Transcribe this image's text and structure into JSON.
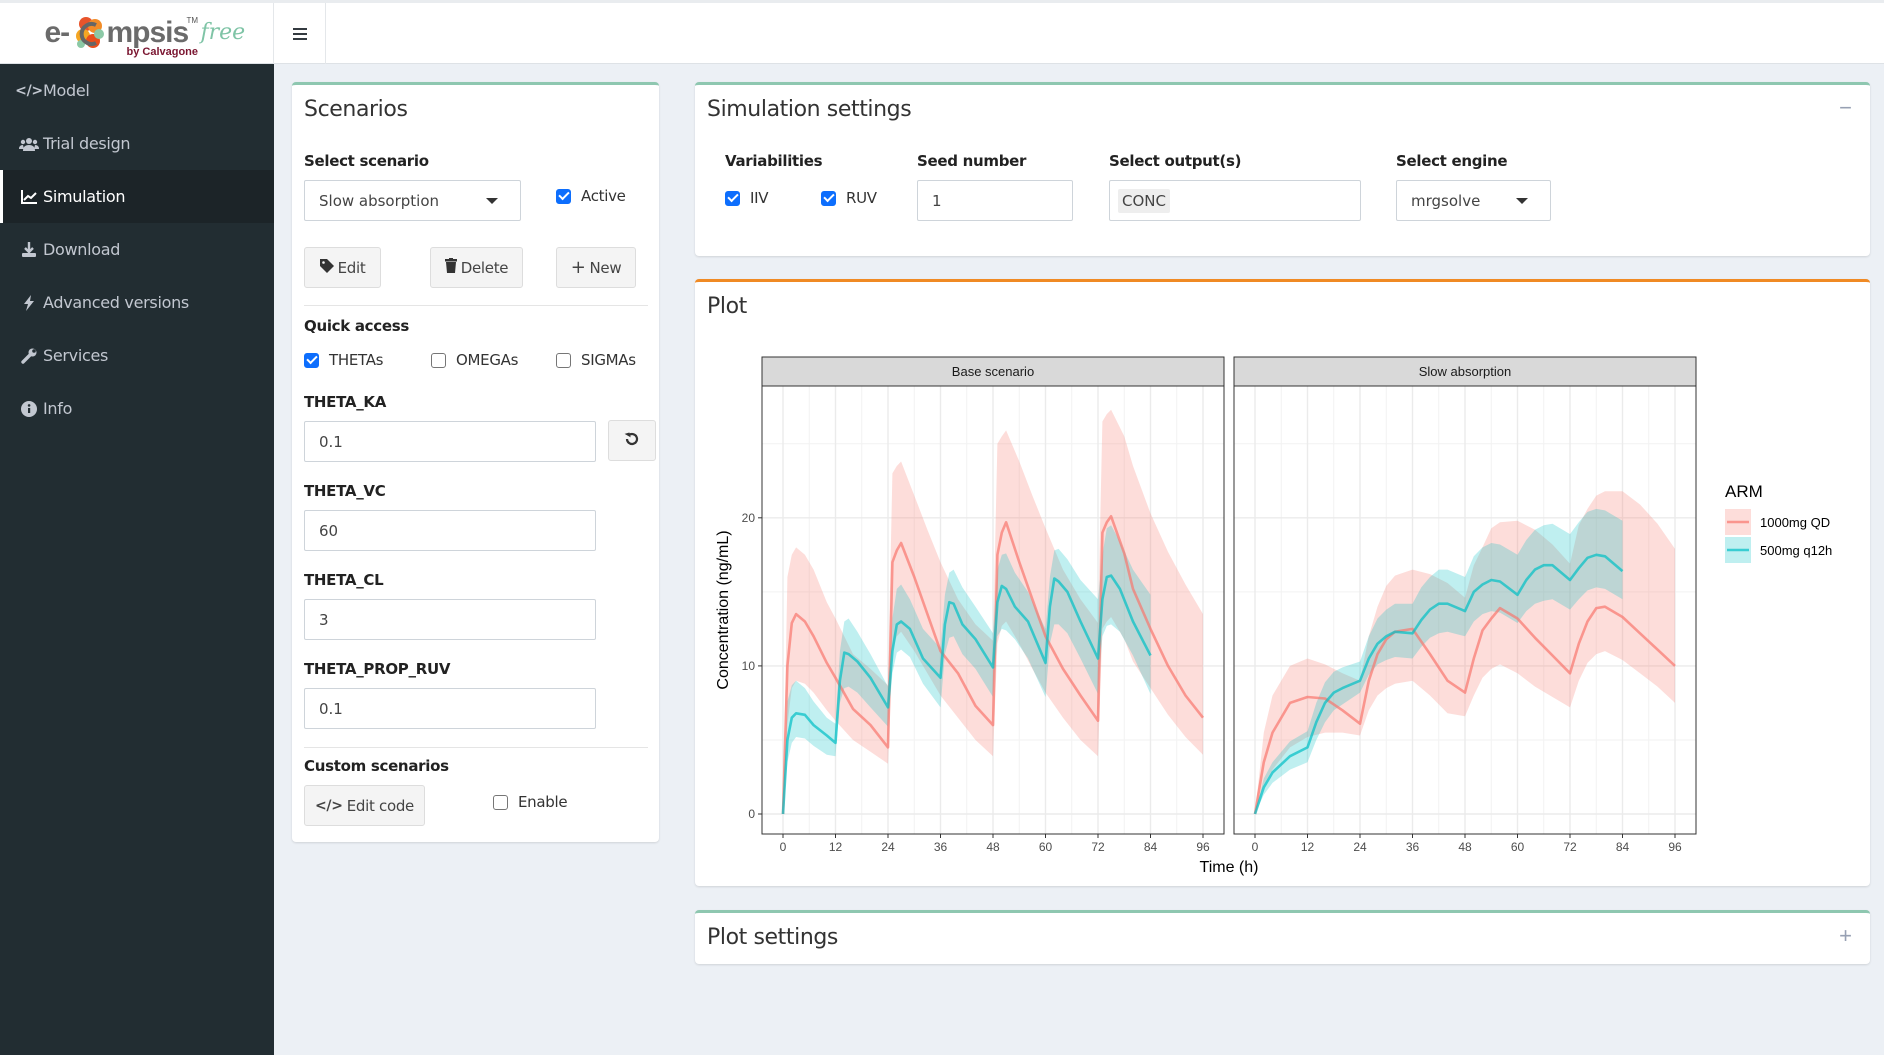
{
  "app": {
    "logo_prefix": "e-",
    "logo_suffix": "mpsis",
    "logo_tm": "TM",
    "logo_free": "free",
    "logo_by": "by Calvagone"
  },
  "sidebar": {
    "items": [
      {
        "label": "Model",
        "icon": "code-icon",
        "glyph": "</>",
        "active": false
      },
      {
        "label": "Trial design",
        "icon": "users-icon",
        "glyph": "👥",
        "active": false
      },
      {
        "label": "Simulation",
        "icon": "chart-line-icon",
        "glyph": "📈",
        "active": true
      },
      {
        "label": "Download",
        "icon": "download-icon",
        "glyph": "⤓",
        "active": false
      },
      {
        "label": "Advanced versions",
        "icon": "bolt-icon",
        "glyph": "⚡",
        "active": false
      },
      {
        "label": "Services",
        "icon": "wrench-icon",
        "glyph": "🔧",
        "active": false
      },
      {
        "label": "Info",
        "icon": "info-circle-icon",
        "glyph": "ℹ",
        "active": false
      }
    ]
  },
  "scenarios": {
    "title": "Scenarios",
    "select_label": "Select scenario",
    "selected": "Slow absorption",
    "active_label": "Active",
    "active_checked": true,
    "edit_label": "Edit",
    "delete_label": "Delete",
    "new_label": "New",
    "quick_access_label": "Quick access",
    "quick_access": [
      {
        "label": "THETAs",
        "checked": true
      },
      {
        "label": "OMEGAs",
        "checked": false
      },
      {
        "label": "SIGMAs",
        "checked": false
      }
    ],
    "params": [
      {
        "label": "THETA_KA",
        "value": "0.1"
      },
      {
        "label": "THETA_VC",
        "value": "60"
      },
      {
        "label": "THETA_CL",
        "value": "3"
      },
      {
        "label": "THETA_PROP_RUV",
        "value": "0.1"
      }
    ],
    "custom_label": "Custom scenarios",
    "edit_code_label": "Edit code",
    "enable_label": "Enable",
    "enable_checked": false
  },
  "sim_settings": {
    "title": "Simulation settings",
    "collapse_symbol": "−",
    "variabilities_label": "Variabilities",
    "iiv_label": "IIV",
    "iiv_checked": true,
    "ruv_label": "RUV",
    "ruv_checked": true,
    "seed_label": "Seed number",
    "seed_value": "1",
    "output_label": "Select output(s)",
    "output_value": "CONC",
    "engine_label": "Select engine",
    "engine_value": "mrgsolve"
  },
  "plot": {
    "title": "Plot"
  },
  "plot_settings": {
    "title": "Plot settings",
    "expand_symbol": "+"
  },
  "chart_data": {
    "type": "area",
    "title": "",
    "xlabel": "Time (h)",
    "ylabel": "Concentration (ng/mL)",
    "xlim": [
      -4.8,
      100.8
    ],
    "ylim": [
      -1.35,
      28.9
    ],
    "xticks": [
      0,
      12,
      24,
      36,
      48,
      60,
      72,
      84,
      96
    ],
    "yticks": [
      0,
      10,
      20
    ],
    "grid": true,
    "legend": {
      "title": "ARM",
      "position": "right",
      "entries": [
        "1000mg QD",
        "500mg q12h"
      ]
    },
    "colors": {
      "1000mg QD": "#f8766d",
      "500mg q12h": "#00bfc4"
    },
    "facets": [
      {
        "name": "Base scenario",
        "series": [
          {
            "name": "1000mg QD",
            "x": [
              0,
              1,
              2,
              3,
              5,
              7,
              10,
              12,
              16,
              20,
              24,
              25,
              26,
              27,
              30,
              33,
              36,
              40,
              44,
              48,
              49,
              50,
              51,
              54,
              57,
              60,
              64,
              68,
              72,
              73,
              74,
              75,
              78,
              80,
              84,
              88,
              92,
              96
            ],
            "median": [
              0,
              10,
              12.9,
              13.5,
              13,
              12,
              10.2,
              9.2,
              7.1,
              6,
              4.5,
              17,
              17.8,
              18.3,
              16,
              13.5,
              11,
              9.5,
              7.3,
              6,
              17.5,
              19,
              19.7,
              17,
              14.5,
              12,
              9.8,
              8,
              6.3,
              19,
              19.7,
              20.1,
              17.6,
              15.2,
              12.5,
              10,
              8,
              6.5
            ],
            "lower": [
              0,
              6,
              8.5,
              9,
              8.8,
              8.2,
              7,
              6.3,
              5,
              4.2,
              3.4,
              11,
              12,
              12.3,
              11,
              9.5,
              8,
              6.5,
              5,
              3.9,
              11.5,
              12.7,
              13,
              11.5,
              9.8,
              8.2,
              6.5,
              5,
              3.9,
              12.5,
              13,
              13.3,
              11.8,
              10.3,
              8.5,
              6.7,
              5.2,
              4.0
            ],
            "upper": [
              0,
              16,
              17.5,
              18,
              17.5,
              16.5,
              14.3,
              13.2,
              10.8,
              9.8,
              8.7,
              23,
              23.5,
              23.8,
              21.5,
              19.2,
              17,
              14.5,
              12.8,
              11.7,
              25,
              25.5,
              25.9,
              23.8,
              21.5,
              19.3,
              16.5,
              14.5,
              12.9,
              26.5,
              27,
              27.3,
              25.5,
              23.5,
              20.3,
              17.7,
              15.5,
              13.5
            ]
          },
          {
            "name": "500mg q12h",
            "x": [
              0,
              1,
              2,
              3,
              5,
              7,
              10,
              12,
              13,
              14,
              15,
              17,
              20,
              24,
              25,
              26,
              27,
              29,
              32,
              36,
              37,
              38,
              39,
              41,
              44,
              48,
              49,
              50,
              51,
              53,
              56,
              60,
              61,
              62,
              63,
              65,
              68,
              72,
              73,
              74,
              75,
              77,
              80,
              84
            ],
            "median": [
              0,
              5,
              6.5,
              6.8,
              6.7,
              6,
              5.3,
              4.8,
              9,
              10.9,
              10.8,
              10.3,
              9.2,
              7.2,
              11,
              12.8,
              13,
              12.5,
              10.5,
              9.2,
              12.8,
              14.3,
              14.2,
              12.8,
              11.8,
              9.9,
              14.3,
              15.4,
              15.2,
              14,
              13,
              10.2,
              14,
              15.9,
              15.7,
              15,
              13,
              10.5,
              14.5,
              16,
              16.1,
              15.2,
              13,
              10.7
            ],
            "lower": [
              0,
              3.5,
              4.8,
              5.2,
              5.1,
              4.6,
              4,
              3.9,
              7.5,
              8.5,
              8.6,
              8.2,
              7.2,
              5.9,
              9.5,
              10.9,
              11.1,
              10.6,
              8.8,
              7.2,
              10.8,
              11.9,
              12,
              10.8,
              9.8,
              7.9,
              12,
              12.5,
              12.4,
              11.8,
              10.5,
              7.9,
              11.5,
              12.8,
              12.8,
              12.2,
              10.5,
              8.1,
              12,
              12.7,
              12.8,
              12.3,
              10.7,
              8.1
            ],
            "upper": [
              0,
              7.6,
              8.7,
              9.0,
              8.5,
              7.6,
              6.5,
              6.1,
              11,
              13,
              13.2,
              12.3,
              10.8,
              8.6,
              13.2,
              15.2,
              15.5,
              14.5,
              12.5,
              11.2,
              14.8,
              16.3,
              16.5,
              15.3,
              14,
              12.2,
              16.5,
              17.5,
              17.6,
              16.3,
              15,
              12.5,
              16,
              17.8,
              17.9,
              17.2,
              15.8,
              14.5,
              17.5,
              19.3,
              19.5,
              18.4,
              16.5,
              14.8
            ]
          }
        ]
      },
      {
        "name": "Slow absorption",
        "series": [
          {
            "name": "1000mg QD",
            "x": [
              0,
              2,
              4,
              8,
              12,
              16,
              20,
              24,
              26,
              28,
              30,
              32,
              36,
              40,
              44,
              48,
              50,
              52,
              54,
              56,
              60,
              64,
              68,
              72,
              74,
              76,
              78,
              80,
              84,
              88,
              92,
              96
            ],
            "median": [
              0,
              3.5,
              5.5,
              7.5,
              7.9,
              7.8,
              7.0,
              6.1,
              9.0,
              10.8,
              11.8,
              12.3,
              12.5,
              10.8,
              9.0,
              8.2,
              10.5,
              12.4,
              13.2,
              13.9,
              13.2,
              11.9,
              10.7,
              9.5,
              11.5,
              13.0,
              13.9,
              14.0,
              13.3,
              12.2,
              11.1,
              10.0
            ],
            "lower": [
              0,
              2.0,
              3.0,
              4.5,
              5.2,
              5.5,
              5.5,
              5.3,
              7.0,
              8.0,
              8.5,
              8.8,
              9.0,
              8.0,
              6.8,
              6.6,
              8.0,
              9.2,
              9.8,
              10.1,
              9.5,
              8.6,
              7.9,
              7.2,
              9.0,
              10.2,
              10.8,
              11.0,
              10.4,
              9.5,
              8.6,
              7.5
            ],
            "upper": [
              0,
              5.5,
              8.0,
              10.0,
              10.5,
              10.1,
              9.5,
              9.0,
              12.0,
              14.0,
              15.4,
              16.1,
              16.5,
              16.2,
              15.6,
              14.6,
              16.8,
              18.0,
              19.3,
              19.7,
              19.8,
              19.2,
              18.2,
              16.9,
              19.5,
              20.6,
              21.5,
              21.8,
              21.8,
              20.9,
              19.6,
              17.9
            ]
          },
          {
            "name": "500mg q12h",
            "x": [
              0,
              2,
              4,
              8,
              12,
              14,
              16,
              18,
              20,
              24,
              26,
              28,
              30,
              32,
              36,
              38,
              40,
              42,
              44,
              48,
              50,
              52,
              54,
              56,
              60,
              62,
              64,
              66,
              68,
              72,
              74,
              76,
              78,
              80,
              84
            ],
            "median": [
              0,
              1.8,
              2.8,
              3.9,
              4.5,
              6.2,
              7.5,
              8.2,
              8.5,
              9.0,
              10.5,
              11.5,
              12.0,
              12.3,
              12.2,
              13.1,
              13.8,
              14.2,
              14.2,
              13.7,
              15.0,
              15.5,
              15.8,
              15.7,
              14.8,
              15.8,
              16.5,
              16.8,
              16.8,
              15.8,
              16.6,
              17.3,
              17.5,
              17.4,
              16.4
            ],
            "lower": [
              0,
              1.3,
              2.1,
              3.0,
              3.5,
              5.0,
              6.2,
              7.0,
              7.4,
              8.2,
              9.4,
              10.1,
              10.4,
              10.6,
              10.5,
              11.3,
              11.9,
              12.2,
              12.3,
              12.0,
              13.0,
              13.5,
              13.7,
              13.6,
              12.9,
              13.7,
              14.2,
              14.4,
              14.5,
              13.8,
              14.5,
              15.1,
              15.3,
              15.2,
              14.5
            ],
            "upper": [
              0,
              2.4,
              3.5,
              4.9,
              5.6,
              7.5,
              8.9,
              9.6,
              9.9,
              10.3,
              12.0,
              13.2,
              13.8,
              14.2,
              14.2,
              15.3,
              16.0,
              16.5,
              16.5,
              16.0,
              17.4,
              18.0,
              18.3,
              18.2,
              17.5,
              18.5,
              19.2,
              19.5,
              19.6,
              18.9,
              19.7,
              20.4,
              20.6,
              20.5,
              19.8
            ]
          }
        ]
      }
    ]
  }
}
